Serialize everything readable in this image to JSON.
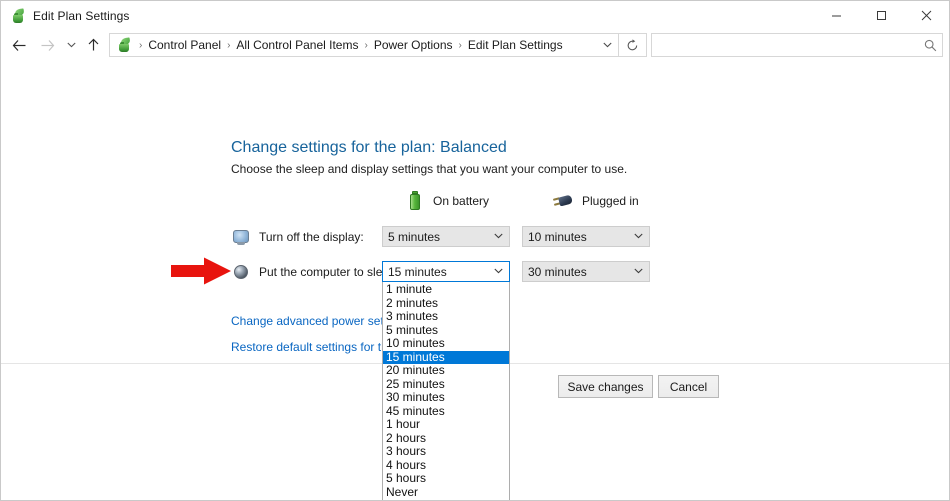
{
  "window": {
    "title": "Edit Plan Settings",
    "title_icon": "power-plan-plant-icon",
    "minimize_label": "—",
    "maximize_label": "□",
    "close_label": "✕"
  },
  "navbar": {
    "back_label": "←",
    "forward_label": "→",
    "recent_label": "∨",
    "up_label": "↑",
    "breadcrumbs": [
      "Control Panel",
      "All Control Panel Items",
      "Power Options",
      "Edit Plan Settings"
    ],
    "separator": "›",
    "dropdown_chevron": "∨",
    "refresh_label": "↻",
    "search": {
      "value": "",
      "placeholder": "",
      "icon": "search-icon"
    }
  },
  "page": {
    "title": "Change settings for the plan: Balanced",
    "subtitle": "Choose the sleep and display settings that you want your computer to use."
  },
  "columns": [
    {
      "label": "On battery",
      "icon": "battery-icon"
    },
    {
      "label": "Plugged in",
      "icon": "plug-icon"
    }
  ],
  "settings": [
    {
      "label": "Turn off the display:",
      "icon": "monitor-icon",
      "battery_value": "5 minutes",
      "plugged_value": "10 minutes",
      "open": false
    },
    {
      "label": "Put the computer to sleep:",
      "icon": "moon-icon",
      "battery_value": "15 minutes",
      "plugged_value": "30 minutes",
      "open": true
    }
  ],
  "dropdown": {
    "selected": "15 minutes",
    "chevron": "∨",
    "options": [
      "1 minute",
      "2 minutes",
      "3 minutes",
      "5 minutes",
      "10 minutes",
      "15 minutes",
      "20 minutes",
      "25 minutes",
      "30 minutes",
      "45 minutes",
      "1 hour",
      "2 hours",
      "3 hours",
      "4 hours",
      "5 hours",
      "Never"
    ]
  },
  "links": {
    "advanced": "Change advanced power settings",
    "restore": "Restore default settings for this plan"
  },
  "buttons": {
    "save": "Save changes",
    "cancel": "Cancel"
  },
  "annotation": {
    "arrow_color": "#e8140e",
    "points_to": "Put the computer to sleep:"
  },
  "colors": {
    "heading": "#17639b",
    "link": "#0966c2",
    "selection": "#0078d7",
    "combo_bg": "#e6e6e6"
  }
}
